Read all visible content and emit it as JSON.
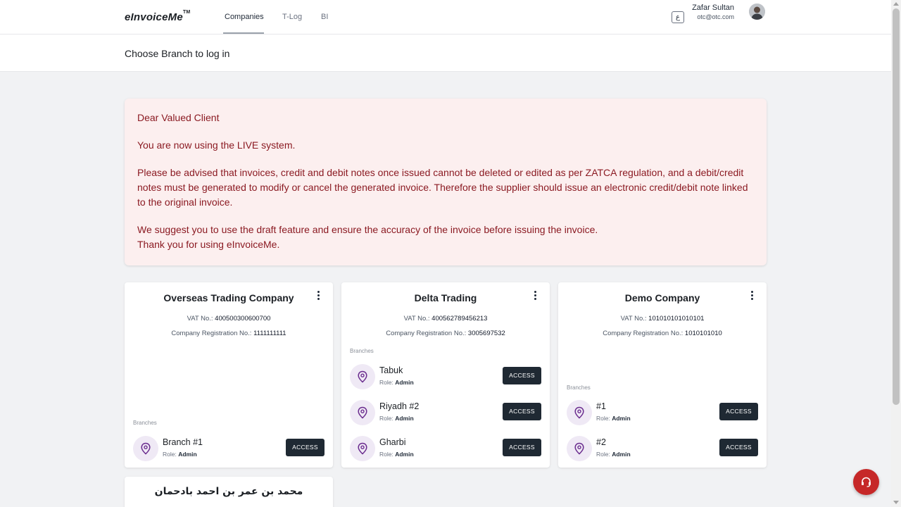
{
  "brand": {
    "name": "eInvoiceMe",
    "tm": "TM"
  },
  "nav": {
    "tabs": [
      {
        "label": "Companies"
      },
      {
        "label": "T-Log"
      },
      {
        "label": "BI"
      }
    ],
    "lang_toggle": "ع"
  },
  "user": {
    "name": "Zafar Sultan",
    "email": "otc@otc.com"
  },
  "page": {
    "title": "Choose Branch to log in"
  },
  "notice": {
    "greeting": "Dear Valued Client",
    "live": "You are now using the LIVE system.",
    "advisory": "Please be advised that invoices, credit and debit notes once issued cannot be deleted or edited as per ZATCA regulation, and a debit/credit notes must be generated to modify or cancel the generated invoice. Therefore the supplier should issue an electronic credit/debit note linked to the original invoice.",
    "suggest": "We suggest you to use the draft feature and ensure the accuracy of the invoice before issuing the invoice.",
    "thanks": "Thank you for using eInvoiceMe."
  },
  "labels": {
    "vat": "VAT No.:",
    "cr": "Company Registration No.:",
    "branches": "Branches",
    "role": "Role:",
    "access": "ACCESS"
  },
  "companies": [
    {
      "name": "Overseas Trading Company",
      "vat": "400500300600700",
      "cr": "1111111111",
      "branches": [
        {
          "name": "Branch #1",
          "role": "Admin"
        }
      ]
    },
    {
      "name": "Delta Trading",
      "vat": "400562789456213",
      "cr": "3005697532",
      "branches": [
        {
          "name": "Tabuk",
          "role": "Admin"
        },
        {
          "name": "Riyadh #2",
          "role": "Admin"
        },
        {
          "name": "Gharbi",
          "role": "Admin"
        }
      ]
    },
    {
      "name": "Demo Company",
      "vat": "101010101010101",
      "cr": "1010101010",
      "branches": [
        {
          "name": "#1",
          "role": "Admin"
        },
        {
          "name": "#2",
          "role": "Admin"
        }
      ]
    },
    {
      "name": "محمد بن عمر بن احمد بادحمان"
    }
  ],
  "colors": {
    "notice_bg": "#fcefef",
    "notice_text": "#8b1a22",
    "access_button": "#1f2933",
    "pin_bg": "#efe9f5",
    "pin_icon": "#6b2d8f",
    "support_button": "#c62828"
  },
  "icons": {
    "pin": "map-pin-icon",
    "menu": "vertical-dots-icon",
    "support": "headset-icon"
  }
}
